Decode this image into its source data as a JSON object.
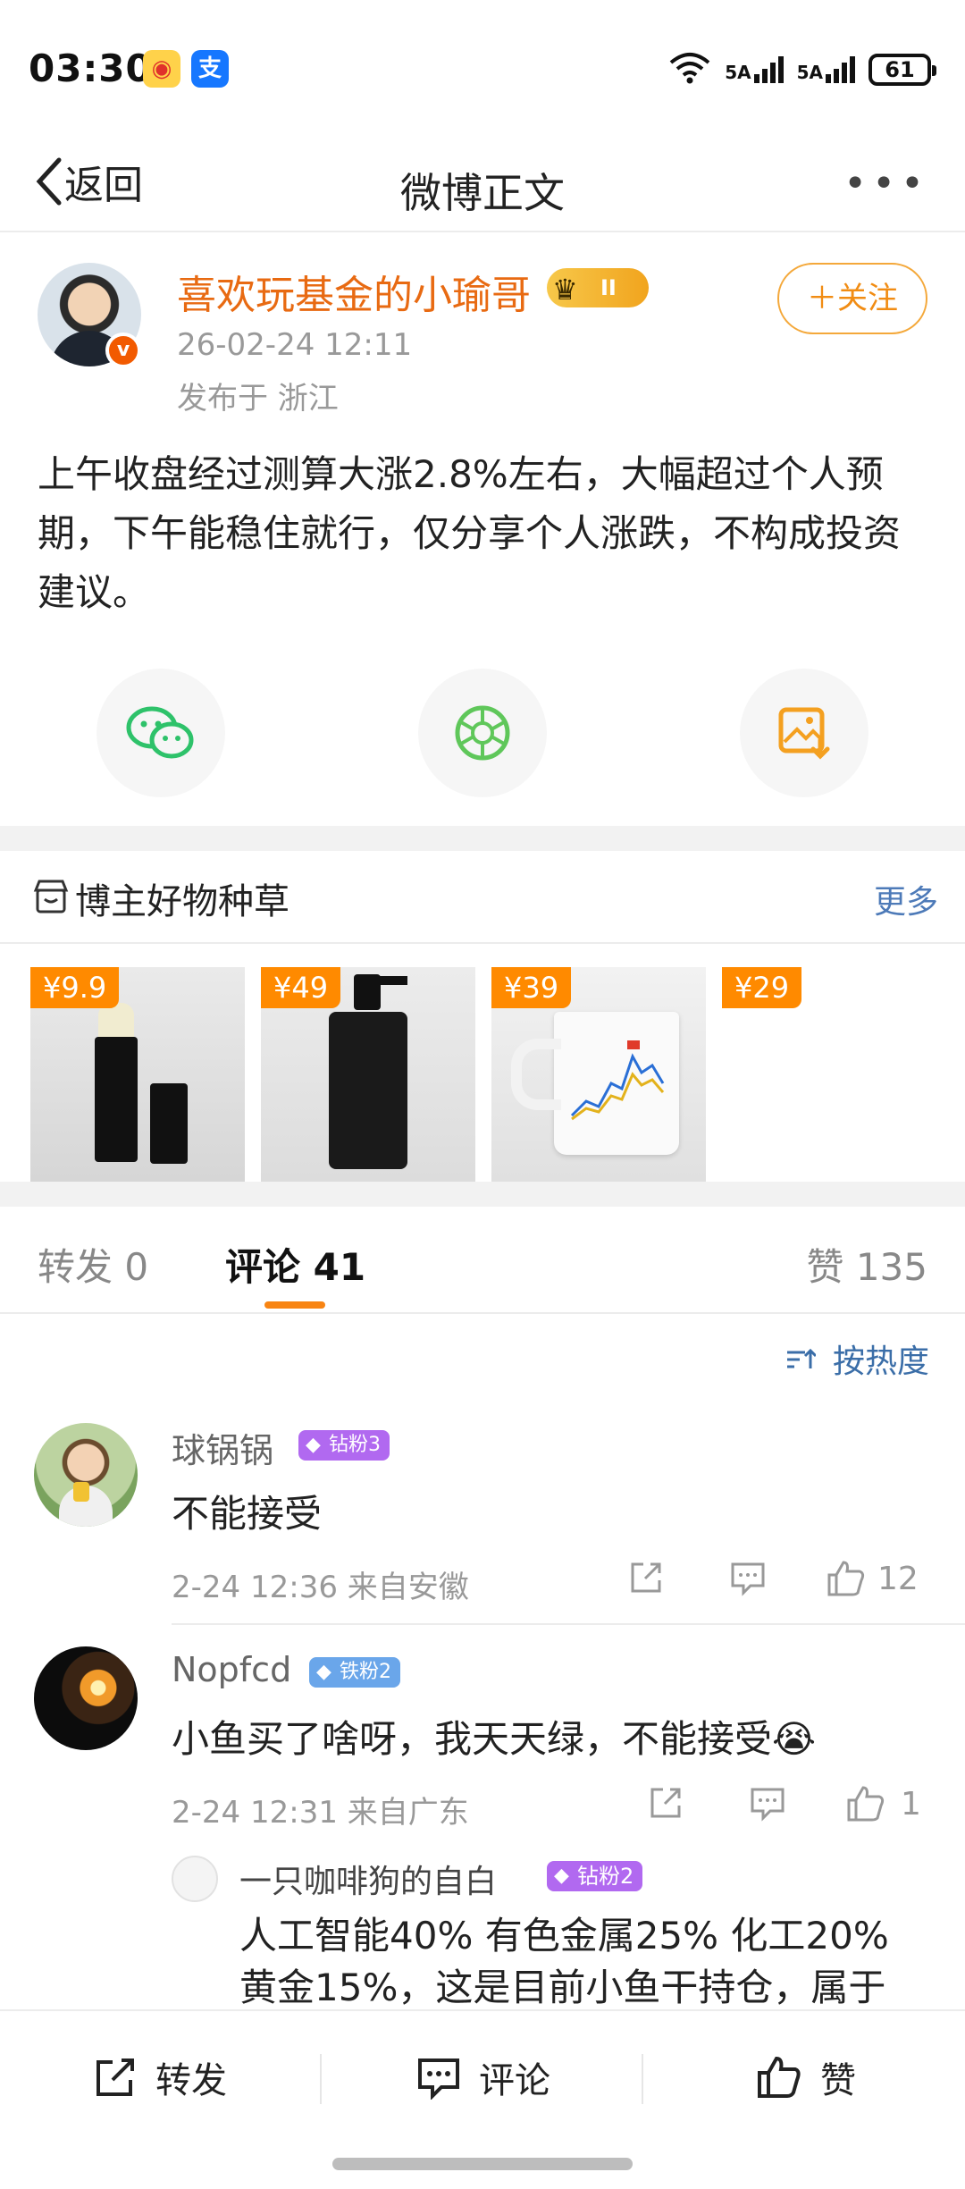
{
  "status_bar": {
    "time": "03:30",
    "battery": "61",
    "signal1": "5A",
    "signal2": "5A",
    "wifi_tag": "6"
  },
  "nav": {
    "back_label": "返回",
    "title": "微博正文"
  },
  "post": {
    "author": "喜欢玩基金的小瑜哥",
    "crown_level": "II",
    "time": "26-02-24 12:11",
    "location": "发布于 浙江",
    "follow_label": "＋关注",
    "text": "上午收盘经过测算大涨2.8%左右，大幅超过个人预期，下午能稳住就行，仅分享个人涨跌，不构成投资建议。"
  },
  "goods": {
    "title": "博主好物种草",
    "more": "更多",
    "items": [
      {
        "price": "¥9.9"
      },
      {
        "price": "¥49"
      },
      {
        "price": "¥39"
      },
      {
        "price": "¥29"
      }
    ]
  },
  "tabs": {
    "repost": "转发 0",
    "comment": "评论 41",
    "like": "赞 135",
    "sort": "按热度"
  },
  "comments": [
    {
      "name": "球锅锅",
      "badge": "钻粉3",
      "text": "不能接受",
      "meta": "2-24 12:36 来自安徽",
      "likes": "12"
    },
    {
      "name": "Nopfcd",
      "badge": "铁粉2",
      "text": "小鱼买了啥呀，我天天绿，不能接受😭",
      "meta": "2-24 12:31 来自广东",
      "likes": "1"
    }
  ],
  "reply": {
    "name": "一只咖啡狗的自白",
    "badge": "钻粉2",
    "line1": "人工智能40% 有色金属25% 化工20%",
    "line2": "黄金15%，这是目前小鱼干持仓，属于"
  },
  "bottom": {
    "repost": "转发",
    "comment": "评论",
    "like": "赞"
  },
  "colors": {
    "accent": "#f88412",
    "link": "#3b6ea8",
    "diamond_badge": "#b169f0",
    "iron_badge": "#6aa6ea"
  }
}
